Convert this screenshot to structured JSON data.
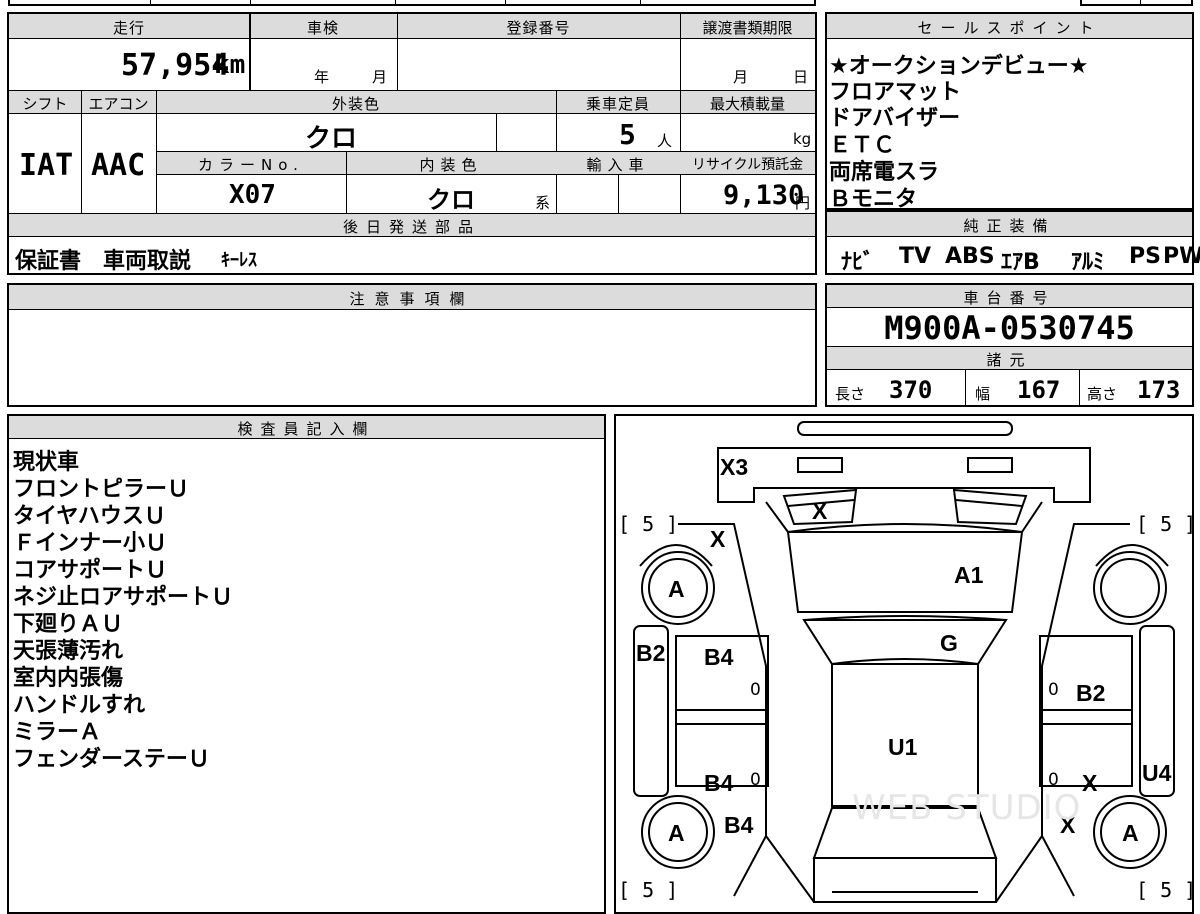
{
  "main": {
    "mileage_label": "走行",
    "inspection_label": "車検",
    "registration_label": "登録番号",
    "transfer_deadline_label": "譲渡書類期限",
    "mileage_value": "57,954",
    "mileage_unit": "km",
    "year_unit": "年",
    "month_unit": "月",
    "day_unit": "日",
    "shift_label": "シフト",
    "aircon_label": "エアコン",
    "exterior_color_label": "外装色",
    "capacity_label": "乗車定員",
    "max_load_label": "最大積載量",
    "shift_value": "IAT",
    "aircon_value": "AAC",
    "exterior_color_value": "クロ",
    "capacity_value": "5",
    "capacity_unit": "人",
    "max_load_unit": "kg",
    "color_no_label": "カラーNo.",
    "interior_color_label": "内装色",
    "import_label": "輸入車",
    "recycle_label": "リサイクル預託金",
    "color_no_value": "X07",
    "interior_color_value": "クロ",
    "interior_color_suffix": "系",
    "recycle_value": "9,130",
    "recycle_unit": "円",
    "later_parts_label": "後日発送部品",
    "later_parts_value": "保証書　車両取説",
    "later_parts_extra": "ｷｰﾚｽ"
  },
  "sales": {
    "label": "セールスポイント",
    "points": [
      "★オークションデビュー★",
      "フロアマット",
      "ドアバイザー",
      "ＥＴＣ",
      "両席電スラ",
      "Ｂモニタ"
    ]
  },
  "equipment": {
    "label": "純正装備",
    "items": [
      "ﾅﾋﾞ",
      "TV",
      "ABS",
      "ｴｱB",
      "ｱﾙﾐ",
      "PS",
      "PW"
    ]
  },
  "notes": {
    "label": "注意事項欄"
  },
  "chassis": {
    "label": "車台番号",
    "value": "M900A-0530745",
    "specs_label": "諸元",
    "length_label": "長さ",
    "length_value": "370",
    "width_label": "幅",
    "width_value": "167",
    "height_label": "高さ",
    "height_value": "173"
  },
  "inspector": {
    "label": "検査員記入欄",
    "lines": [
      "現状車",
      "フロントピラーＵ",
      "タイヤハウスＵ",
      "Ｆインナー小Ｕ",
      "コアサポートＵ",
      "ネジ止ロアサポートＵ",
      "下廻りＡＵ",
      "天張薄汚れ",
      "室内内張傷",
      "ハンドルすれ",
      "ミラーＡ",
      "フェンダーステーＵ"
    ]
  },
  "diagram": {
    "tire_tl": "[ 5 ]",
    "tire_tr": "[ 5 ]",
    "tire_bl": "[ 5 ]",
    "tire_br": "[ 5 ]",
    "wheel_a": "A",
    "marks": {
      "x3": "X3",
      "x_grille": "X",
      "x_front_left": "X",
      "a1": "A1",
      "g": "G",
      "b2_left": "B2",
      "b2_right": "B2",
      "b4_front_left": "B4",
      "b4_rear_left": "B4",
      "b4_rear_wheel": "B4",
      "u1": "U1",
      "x_rear_right": "X",
      "x_rear_right2": "X",
      "u4": "U4",
      "zero": "0"
    },
    "watermark": "WEB STUDIO"
  }
}
